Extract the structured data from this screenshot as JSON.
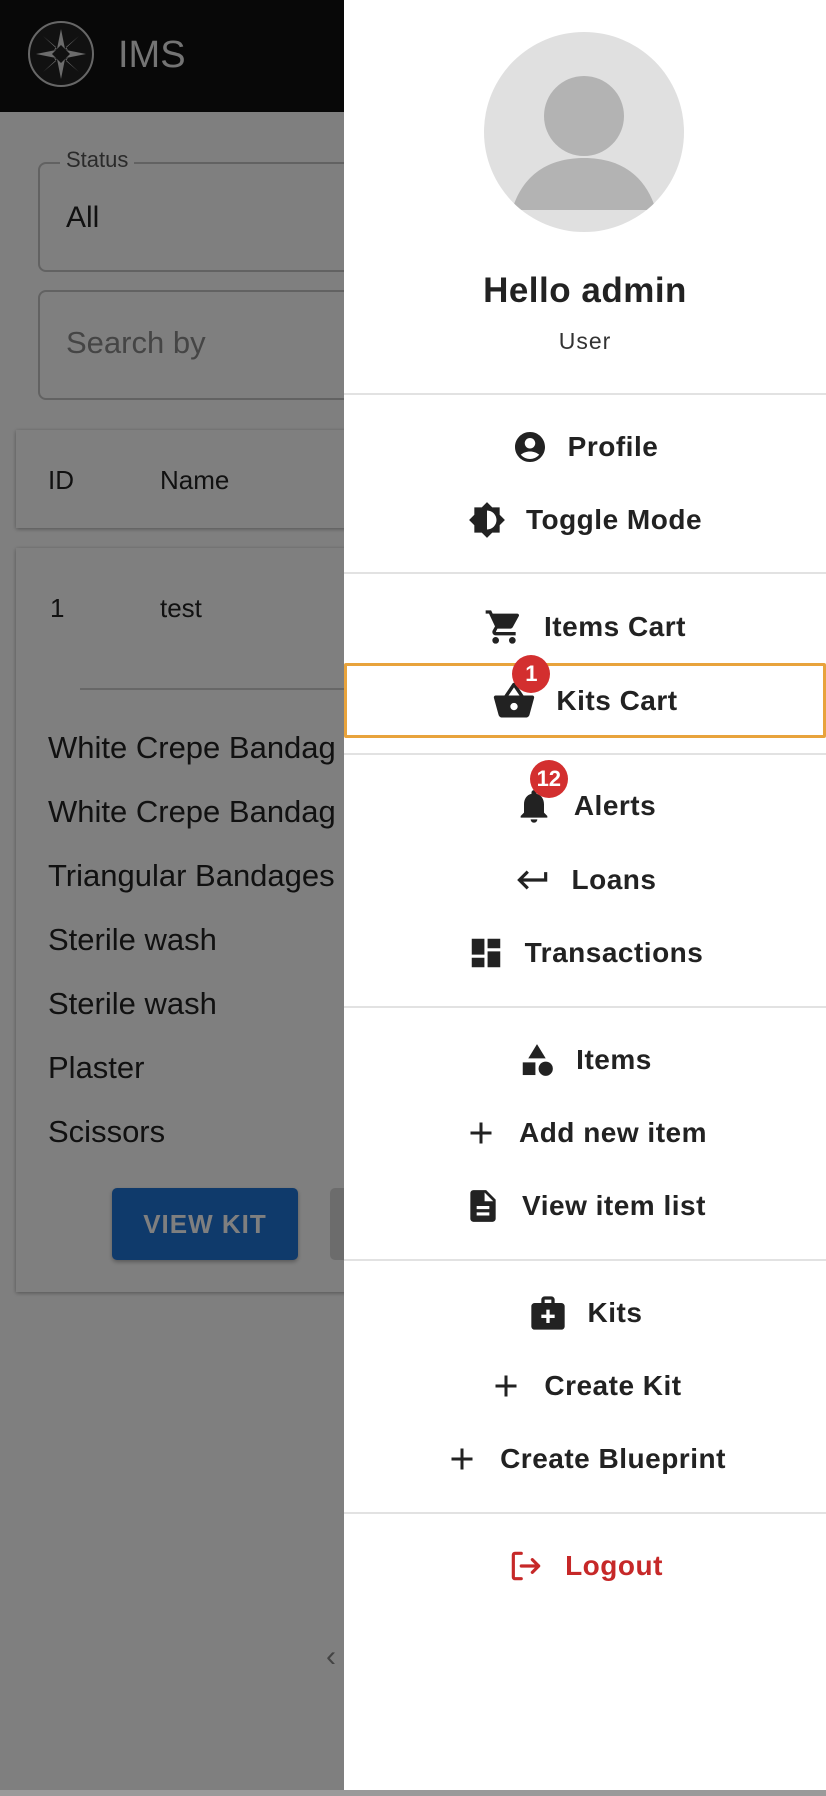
{
  "app": {
    "title": "IMS",
    "filters": {
      "status_label": "Status",
      "status_value": "All",
      "search_placeholder": "Search by"
    },
    "table": {
      "headers": [
        "ID",
        "Name"
      ],
      "row": {
        "id": "1",
        "name": "test"
      },
      "items": [
        "White Crepe Bandag",
        "White Crepe Bandag",
        "Triangular Bandages",
        "Sterile wash",
        "Sterile wash",
        "Plaster",
        "Scissors"
      ],
      "view_kit_label": "VIEW KIT"
    }
  },
  "drawer": {
    "greeting": "Hello admin",
    "role": "User",
    "menu": {
      "profile": "Profile",
      "toggle_mode": "Toggle Mode",
      "items_cart": "Items Cart",
      "kits_cart": "Kits Cart",
      "kits_cart_badge": "1",
      "alerts": "Alerts",
      "alerts_badge": "12",
      "loans": "Loans",
      "transactions": "Transactions",
      "items": "Items",
      "add_new_item": "Add new item",
      "view_item_list": "View item list",
      "kits": "Kits",
      "create_kit": "Create Kit",
      "create_blueprint": "Create Blueprint",
      "logout": "Logout"
    }
  },
  "colors": {
    "accent_outline": "#e8a33c",
    "badge": "#d32f2f",
    "logout": "#c62828",
    "primary_button": "#1f74d6"
  },
  "icons": [
    "account-circle-icon",
    "brightness-icon",
    "cart-icon",
    "basket-icon",
    "bell-icon",
    "return-arrow-icon",
    "dashboard-icon",
    "shapes-icon",
    "plus-icon",
    "document-icon",
    "medical-bag-icon",
    "logout-icon"
  ]
}
